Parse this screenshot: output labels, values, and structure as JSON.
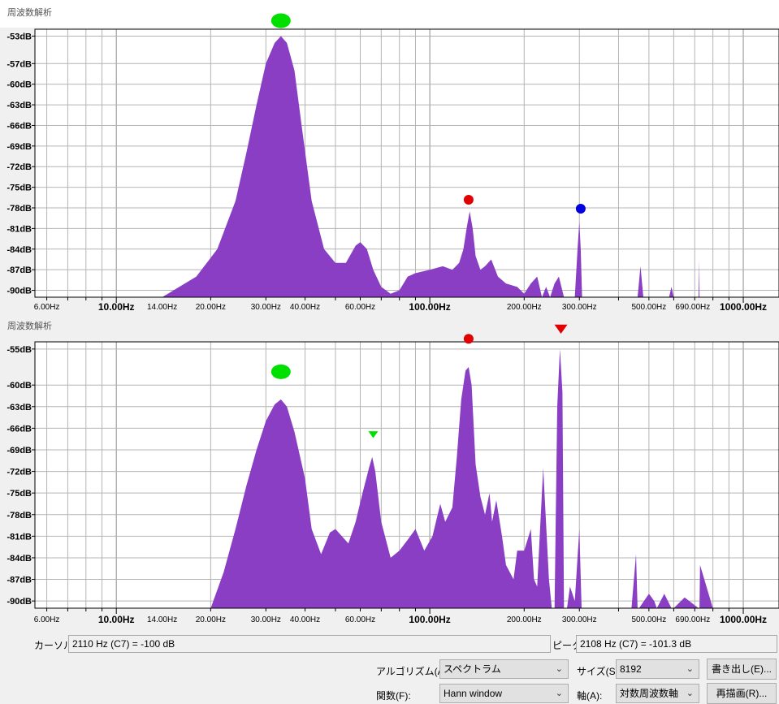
{
  "chart_data": [
    {
      "type": "area",
      "title": "周波数解析",
      "x_scale": "log",
      "xlim": [
        5.5,
        1300
      ],
      "ylim": [
        -91,
        -52
      ],
      "y_ticks": [
        "-53dB",
        "-57dB",
        "-60dB",
        "-63dB",
        "-66dB",
        "-69dB",
        "-72dB",
        "-75dB",
        "-78dB",
        "-81dB",
        "-84dB",
        "-87dB",
        "-90dB"
      ],
      "y_tick_values": [
        -53,
        -57,
        -60,
        -63,
        -66,
        -69,
        -72,
        -75,
        -78,
        -81,
        -84,
        -87,
        -90
      ],
      "x_ticks_minor": [
        {
          "v": 6,
          "label": "6.00Hz"
        },
        {
          "v": 14,
          "label": "14.00Hz"
        },
        {
          "v": 20,
          "label": "20.00Hz"
        },
        {
          "v": 30,
          "label": "30.00Hz"
        },
        {
          "v": 40,
          "label": "40.00Hz"
        },
        {
          "v": 60,
          "label": "60.00Hz"
        },
        {
          "v": 200,
          "label": "200.00Hz"
        },
        {
          "v": 300,
          "label": "300.00Hz"
        },
        {
          "v": 500,
          "label": "500.00Hz"
        },
        {
          "v": 690,
          "label": "690.00Hz"
        }
      ],
      "x_ticks_major": [
        {
          "v": 10,
          "label": "10.00Hz"
        },
        {
          "v": 100,
          "label": "100.00Hz"
        },
        {
          "v": 1000,
          "label": "1000.00Hz"
        }
      ],
      "grid": true,
      "fill": "#8a3ec4",
      "series": [
        {
          "x": [
            14,
            18,
            21,
            24,
            26,
            28,
            30,
            32,
            33.5,
            35,
            37,
            39,
            42,
            46,
            50,
            54,
            58,
            60,
            63,
            66,
            70,
            75,
            80,
            85,
            90,
            100,
            110,
            118,
            124,
            128,
            131,
            134,
            137,
            140,
            145,
            150,
            157,
            165,
            175,
            190,
            200,
            210,
            220,
            228,
            235,
            242,
            250,
            258,
            268,
            280,
            290,
            296,
            300,
            303,
            306,
            310,
            330,
            350,
            400,
            440,
            460,
            470,
            480,
            560,
            580,
            590,
            600,
            650,
            720,
            722,
            725,
            728,
            800,
            1300
          ],
          "y": [
            -91,
            -88,
            -84,
            -77,
            -70,
            -63,
            -57,
            -54,
            -53,
            -54,
            -58,
            -66,
            -77,
            -84,
            -86,
            -86,
            -83.5,
            -83,
            -84,
            -87,
            -89.5,
            -90.5,
            -90,
            -88,
            -87.5,
            -87,
            -86.5,
            -87,
            -86,
            -84,
            -81,
            -78.5,
            -81,
            -85,
            -87,
            -86.5,
            -85.5,
            -88,
            -89,
            -89.5,
            -90.5,
            -89,
            -88,
            -91,
            -89.5,
            -91,
            -89,
            -88,
            -91,
            -91,
            -91,
            -84,
            -80,
            -84,
            -91,
            -91,
            -91,
            -91,
            -91,
            -91,
            -91,
            -86.5,
            -91,
            -91,
            -91,
            -89.5,
            -91,
            -91,
            -91,
            -85.5,
            -91,
            -91,
            -91,
            -91
          ]
        }
      ],
      "markers": [
        {
          "x": 33.5,
          "y": -53,
          "shape": "ellipse",
          "color": "#00e000"
        },
        {
          "x": 133,
          "y": -78,
          "shape": "circle",
          "color": "#e00000"
        },
        {
          "x": 303,
          "y": -79.3,
          "shape": "circle",
          "color": "#0000e0"
        }
      ]
    },
    {
      "type": "area",
      "title": "周波数解析",
      "x_scale": "log",
      "xlim": [
        5.5,
        1300
      ],
      "ylim": [
        -91,
        -54
      ],
      "y_ticks": [
        "-55dB",
        "-60dB",
        "-63dB",
        "-66dB",
        "-69dB",
        "-72dB",
        "-75dB",
        "-78dB",
        "-81dB",
        "-84dB",
        "-87dB",
        "-90dB"
      ],
      "y_tick_values": [
        -55,
        -60,
        -63,
        -66,
        -69,
        -72,
        -75,
        -78,
        -81,
        -84,
        -87,
        -90
      ],
      "x_ticks_minor": [
        {
          "v": 6,
          "label": "6.00Hz"
        },
        {
          "v": 14,
          "label": "14.00Hz"
        },
        {
          "v": 20,
          "label": "20.00Hz"
        },
        {
          "v": 30,
          "label": "30.00Hz"
        },
        {
          "v": 40,
          "label": "40.00Hz"
        },
        {
          "v": 60,
          "label": "60.00Hz"
        },
        {
          "v": 200,
          "label": "200.00Hz"
        },
        {
          "v": 300,
          "label": "300.00Hz"
        },
        {
          "v": 500,
          "label": "500.00Hz"
        },
        {
          "v": 690,
          "label": "690.00Hz"
        }
      ],
      "x_ticks_major": [
        {
          "v": 10,
          "label": "10.00Hz"
        },
        {
          "v": 100,
          "label": "100.00Hz"
        },
        {
          "v": 1000,
          "label": "1000.00Hz"
        }
      ],
      "grid": true,
      "fill": "#8a3ec4",
      "series": [
        {
          "x": [
            20,
            22,
            24,
            26,
            28,
            30,
            32,
            33.5,
            35,
            37,
            40,
            42,
            45,
            48,
            50,
            55,
            58,
            61,
            64,
            65.5,
            67,
            70,
            75,
            80,
            85,
            90,
            96,
            102,
            108,
            112,
            118,
            122,
            126,
            130,
            133,
            136,
            140,
            145,
            150,
            155,
            158,
            163,
            170,
            175,
            180,
            185,
            190,
            200,
            210,
            215,
            220,
            230,
            240,
            245,
            250,
            255,
            260,
            265,
            268,
            271,
            274,
            280,
            290,
            300,
            305,
            310,
            330,
            360,
            400,
            440,
            455,
            460,
            465,
            500,
            520,
            530,
            560,
            590,
            600,
            650,
            720,
            722,
            725,
            728,
            800,
            1300
          ],
          "y": [
            -91,
            -86,
            -80,
            -74,
            -69,
            -65,
            -62.7,
            -62,
            -63,
            -66.5,
            -73,
            -80,
            -83.5,
            -80.5,
            -80,
            -82,
            -79,
            -75,
            -71.5,
            -70,
            -72,
            -79,
            -84,
            -83,
            -81.5,
            -80,
            -83,
            -81,
            -76.5,
            -79,
            -77,
            -70,
            -62,
            -58,
            -57.5,
            -60,
            -71,
            -75.5,
            -78,
            -75,
            -79,
            -76,
            -81,
            -85,
            -86,
            -87,
            -83,
            -83,
            -80,
            -87,
            -88,
            -71.5,
            -87,
            -91,
            -91,
            -63,
            -55,
            -61,
            -91,
            -91,
            -91,
            -88,
            -90,
            -80,
            -91,
            -91,
            -91,
            -91,
            -91,
            -91,
            -83.5,
            -91,
            -91,
            -89,
            -90,
            -91,
            -89,
            -91,
            -91,
            -89.5,
            -91,
            -91,
            -91,
            -85,
            -91,
            -91
          ]
        }
      ],
      "markers": [
        {
          "x": 33.5,
          "y": -60.3,
          "shape": "ellipse",
          "color": "#00e000"
        },
        {
          "x": 133,
          "y": -54.7,
          "shape": "circle",
          "color": "#e00000"
        },
        {
          "x": 66,
          "y": -68.5,
          "shape": "triangle-down",
          "color": "#00e000"
        },
        {
          "x": 262,
          "y": -54,
          "shape": "triangle-down",
          "color": "#e00000"
        }
      ]
    }
  ],
  "controls": {
    "cursor_label": "カーソル:",
    "cursor_value": "2110 Hz (C7) = -100 dB",
    "peak_label": "ピーク:",
    "peak_value": "2108 Hz (C7) = -101.3 dB",
    "algorithm_label": "アルゴリズム(A):",
    "algorithm_value": "スペクトラム",
    "size_label": "サイズ(S):",
    "size_value": "8192",
    "export_button": "書き出し(E)...",
    "function_label": "関数(F):",
    "function_value": "Hann window",
    "axis_label": "軸(A):",
    "axis_value": "対数周波数軸",
    "replot_button": "再描画(R)...",
    "chevron_icon": "chevron-down-icon"
  }
}
